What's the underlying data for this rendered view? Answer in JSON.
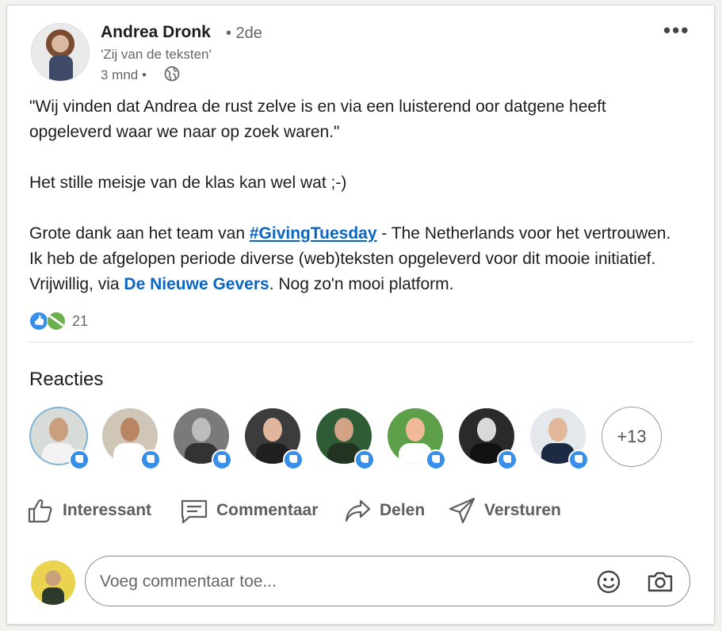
{
  "author": {
    "name": "Andrea Dronk",
    "degree": "• 2de",
    "headline": "'Zij van de teksten'",
    "time": "3 mnd •"
  },
  "menu": {
    "more_label": "•••"
  },
  "post": {
    "line1": "\"Wij vinden dat Andrea de rust zelve is en via een luisterend oor datgene heeft opgeleverd waar we naar op zoek waren.\"",
    "line2": "Het stille meisje van de klas kan wel wat ;-)",
    "line3_before": "Grote dank aan het team van ",
    "hashtag": "#GivingTuesday",
    "line3_mid": " - The Netherlands voor het vertrouwen. Ik heb de afgelopen periode diverse (web)teksten opgeleverd voor dit mooie initiatief. Vrijwillig, via ",
    "mention": "De Nieuwe Gevers",
    "line3_after": ". Nog zo'n mooi platform."
  },
  "reactions": {
    "count": "21",
    "icons": [
      "like-icon",
      "celebrate-icon"
    ]
  },
  "reacties": {
    "heading": "Reacties",
    "more_count": "+13",
    "faces": [
      {
        "bg": "#d8dcd8",
        "skin": "#c99f80",
        "shirt": "#f2f2f2",
        "ring": "#7fb3d5"
      },
      {
        "bg": "#cfc6b8",
        "skin": "#b98562",
        "shirt": "#ffffff",
        "ring": ""
      },
      {
        "bg": "#7a7a7a",
        "skin": "#bdbdbd",
        "shirt": "#333333",
        "ring": ""
      },
      {
        "bg": "#3c3c3c",
        "skin": "#e0b79c",
        "shirt": "#1f1f1f",
        "ring": ""
      },
      {
        "bg": "#2f5b35",
        "skin": "#d2a385",
        "shirt": "#223322",
        "ring": ""
      },
      {
        "bg": "#5da049",
        "skin": "#f0b99a",
        "shirt": "#ffffff",
        "ring": ""
      },
      {
        "bg": "#2a2a2a",
        "skin": "#d9d9d9",
        "shirt": "#111111",
        "ring": ""
      },
      {
        "bg": "#e4e8ec",
        "skin": "#e2b89a",
        "shirt": "#1d2a44",
        "ring": ""
      }
    ]
  },
  "actions": {
    "like": "Interessant",
    "comment": "Commentaar",
    "share": "Delen",
    "send": "Versturen"
  },
  "comment": {
    "placeholder": "Voeg commentaar toe..."
  },
  "colors": {
    "link": "#0a66c2",
    "like_badge": "#378fe9",
    "text_secondary": "#666666"
  }
}
